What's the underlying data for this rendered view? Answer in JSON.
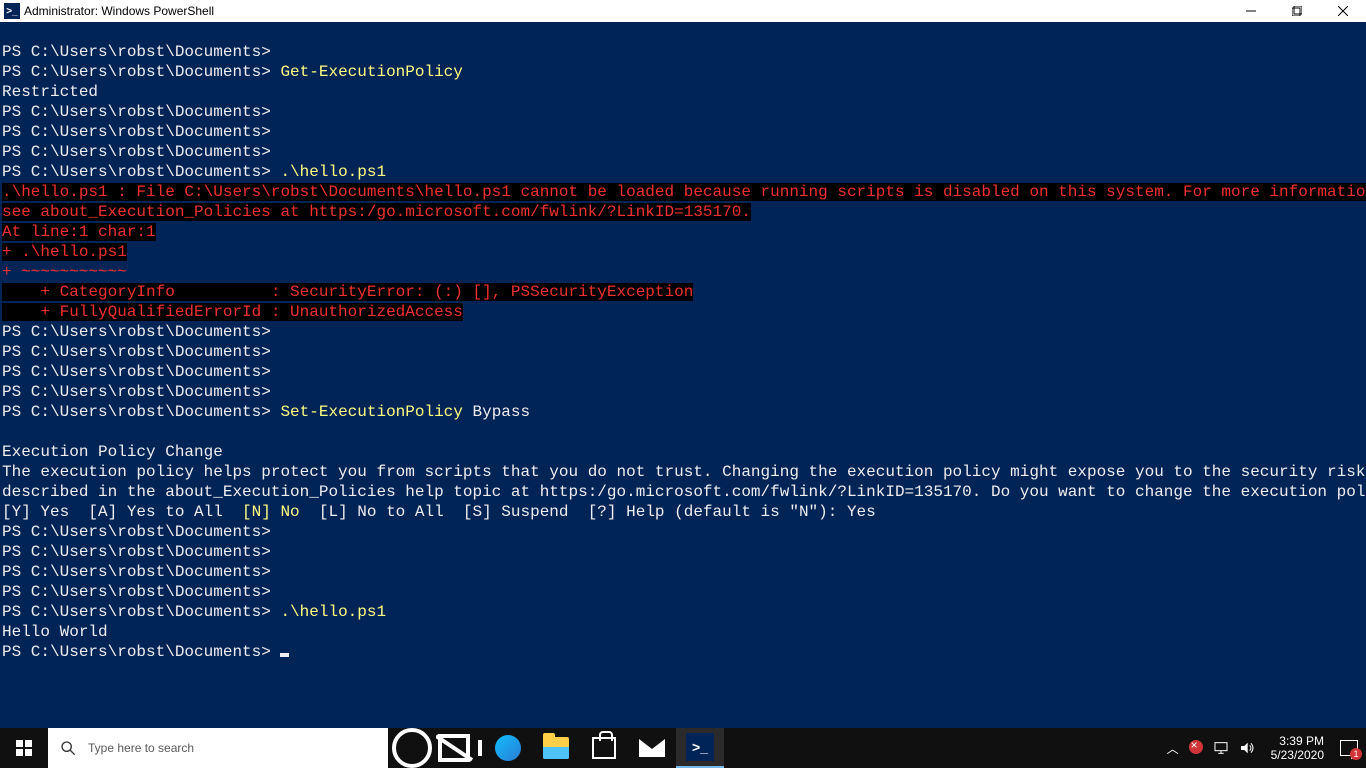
{
  "titlebar": {
    "title": "Administrator: Windows PowerShell",
    "icon_label": ">_"
  },
  "prompt": "PS C:\\Users\\robst\\Documents>",
  "cmds": {
    "get_exec": "Get-ExecutionPolicy",
    "restricted": "Restricted",
    "hello": ".\\hello.ps1",
    "set_exec": "Set-ExecutionPolicy",
    "bypass": " Bypass",
    "hello_world": "Hello World"
  },
  "error": {
    "l1": ".\\hello.ps1 : File C:\\Users\\robst\\Documents\\hello.ps1 cannot be loaded because running scripts is disabled on this system. For more information,",
    "l2": "see about_Execution_Policies at https:/go.microsoft.com/fwlink/?LinkID=135170.",
    "l3": "At line:1 char:1",
    "l4": "+ .\\hello.ps1",
    "l5": "+ ~~~~~~~~~~~",
    "l6": "    + CategoryInfo          : SecurityError: (:) [], PSSecurityException",
    "l7": "    + FullyQualifiedErrorId : UnauthorizedAccess"
  },
  "policy": {
    "head": "Execution Policy Change",
    "body1": "The execution policy helps protect you from scripts that you do not trust. Changing the execution policy might expose you to the security risks",
    "body2": "described in the about_Execution_Policies help topic at https:/go.microsoft.com/fwlink/?LinkID=135170. Do you want to change the execution policy?",
    "opts_pre": "[Y] Yes  [A] Yes to All  ",
    "opts_no": "[N] No",
    "opts_post": "  [L] No to All  [S] Suspend  [?] Help (default is \"N\"): Yes"
  },
  "taskbar": {
    "search_placeholder": "Type here to search",
    "time": "3:39 PM",
    "date": "5/23/2020",
    "notif_count": "1"
  }
}
